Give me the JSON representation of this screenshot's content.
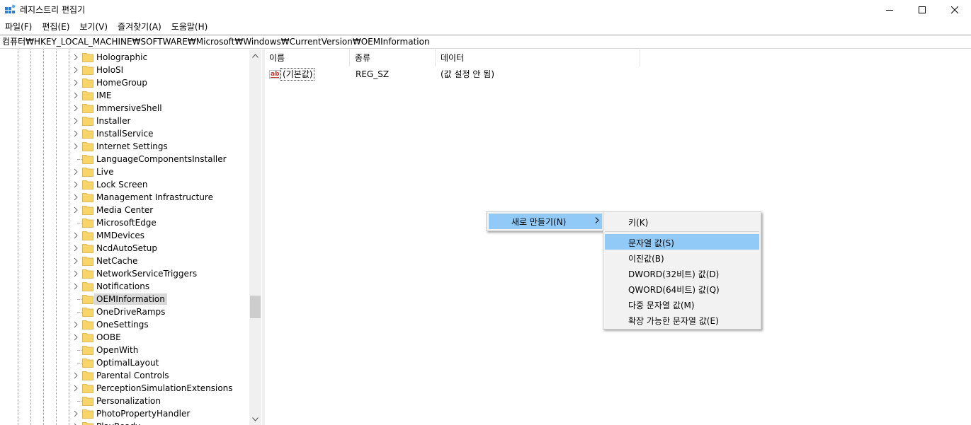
{
  "window": {
    "title": "레지스트리 편집기"
  },
  "menu": [
    "파일(F)",
    "편집(E)",
    "보기(V)",
    "즐겨찾기(A)",
    "도움말(H)"
  ],
  "address": "컴퓨터₩HKEY_LOCAL_MACHINE₩SOFTWARE₩Microsoft₩Windows₩CurrentVersion₩OEMInformation",
  "tree": {
    "items": [
      {
        "label": "Holographic",
        "expandable": true
      },
      {
        "label": "HoloSI",
        "expandable": true
      },
      {
        "label": "HomeGroup",
        "expandable": true
      },
      {
        "label": "IME",
        "expandable": true
      },
      {
        "label": "ImmersiveShell",
        "expandable": true
      },
      {
        "label": "Installer",
        "expandable": true
      },
      {
        "label": "InstallService",
        "expandable": true
      },
      {
        "label": "Internet Settings",
        "expandable": true
      },
      {
        "label": "LanguageComponentsInstaller",
        "expandable": false
      },
      {
        "label": "Live",
        "expandable": true
      },
      {
        "label": "Lock Screen",
        "expandable": true
      },
      {
        "label": "Management Infrastructure",
        "expandable": true
      },
      {
        "label": "Media Center",
        "expandable": true
      },
      {
        "label": "MicrosoftEdge",
        "expandable": false
      },
      {
        "label": "MMDevices",
        "expandable": true
      },
      {
        "label": "NcdAutoSetup",
        "expandable": true
      },
      {
        "label": "NetCache",
        "expandable": true
      },
      {
        "label": "NetworkServiceTriggers",
        "expandable": true
      },
      {
        "label": "Notifications",
        "expandable": true
      },
      {
        "label": "OEMInformation",
        "expandable": false,
        "selected": true
      },
      {
        "label": "OneDriveRamps",
        "expandable": false
      },
      {
        "label": "OneSettings",
        "expandable": true
      },
      {
        "label": "OOBE",
        "expandable": true
      },
      {
        "label": "OpenWith",
        "expandable": false
      },
      {
        "label": "OptimalLayout",
        "expandable": false
      },
      {
        "label": "Parental Controls",
        "expandable": true
      },
      {
        "label": "PerceptionSimulationExtensions",
        "expandable": true
      },
      {
        "label": "Personalization",
        "expandable": false
      },
      {
        "label": "PhotoPropertyHandler",
        "expandable": true
      },
      {
        "label": "PlayReady",
        "expandable": true
      }
    ]
  },
  "list": {
    "columns": [
      "이름",
      "종류",
      "데이터"
    ],
    "rows": [
      {
        "name": "(기본값)",
        "type": "REG_SZ",
        "data": "(값 설정 안 됨)",
        "icon": "string-value-icon"
      }
    ]
  },
  "context_menu": {
    "new_label": "새로 만들기(N)",
    "submenu": [
      "키(K)",
      "문자열 값(S)",
      "이진값(B)",
      "DWORD(32비트) 값(D)",
      "QWORD(64비트) 값(Q)",
      "다중 문자열 값(M)",
      "확장 가능한 문자열 값(E)"
    ],
    "highlighted_index": 1
  },
  "colors": {
    "highlight": "#91c9f7",
    "selection": "#d9d9d9",
    "folder": "#f7d56b"
  }
}
